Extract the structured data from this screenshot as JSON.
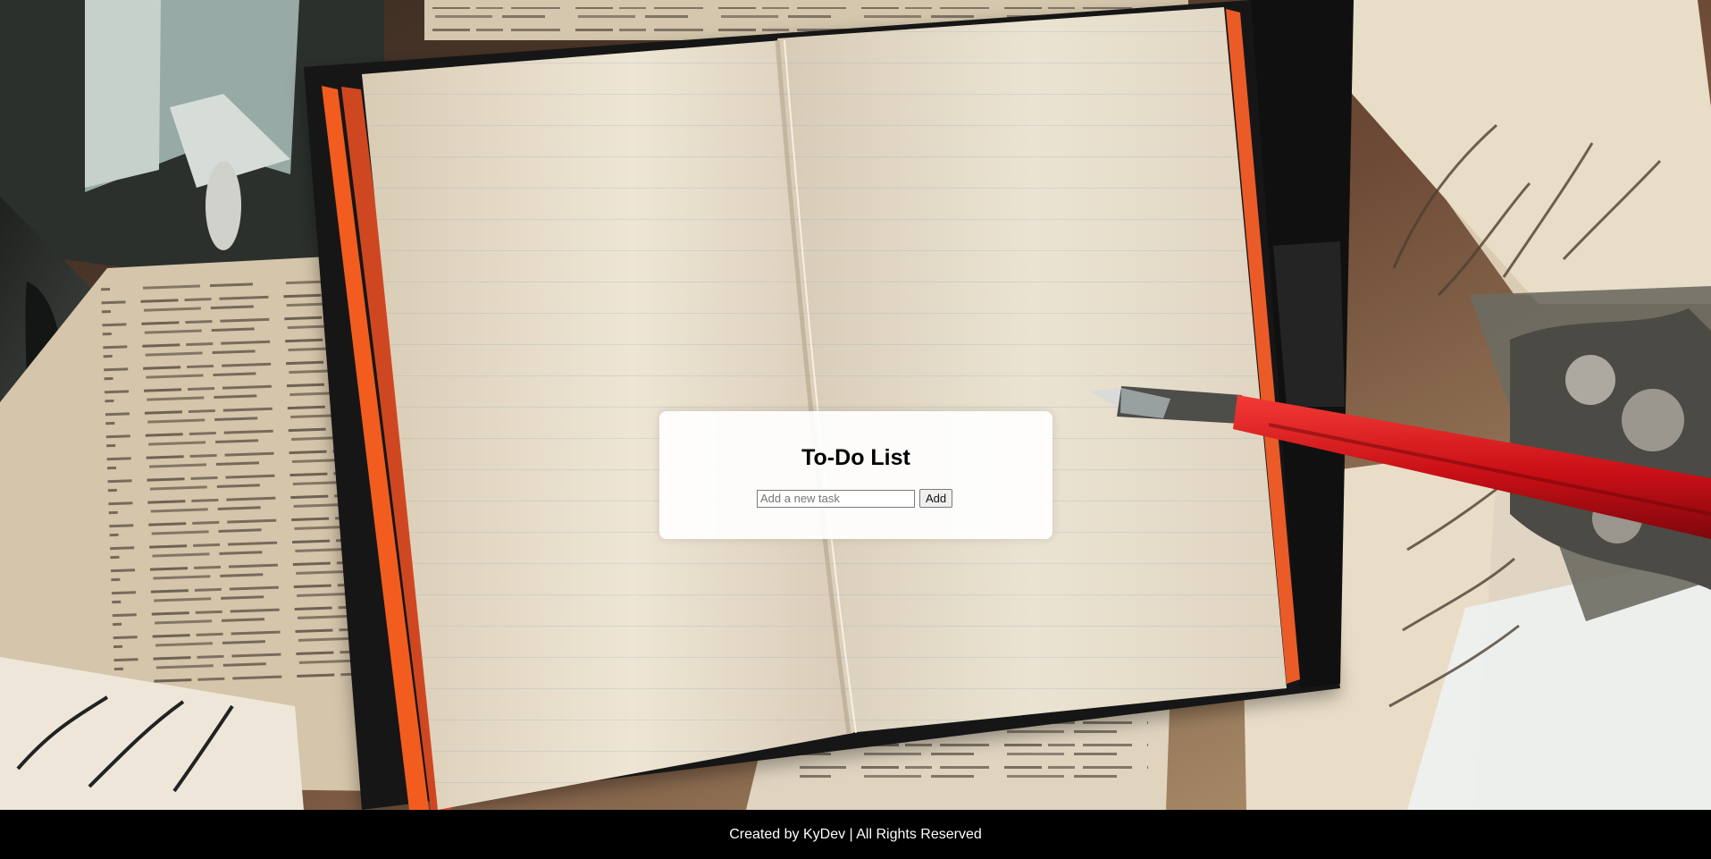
{
  "background": {
    "image_name": "vintage-notebook-and-fountain-pen-background"
  },
  "todo": {
    "title": "To-Do List",
    "input_placeholder": "Add a new task",
    "input_value": "",
    "add_button_label": "Add",
    "tasks": []
  },
  "footer": {
    "text": "Created by KyDev | All Rights Reserved"
  },
  "colors": {
    "footer_background": "#000000",
    "footer_text": "#ffffff",
    "card_background": "#ffffff"
  }
}
